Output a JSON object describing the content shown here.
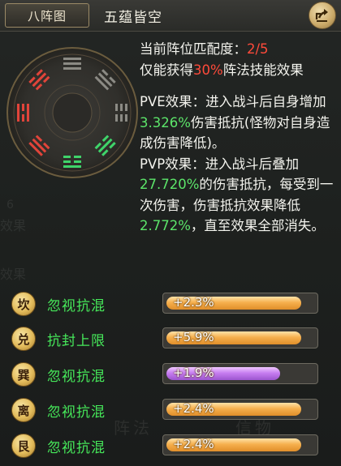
{
  "header": {
    "tab_label": "八阵图",
    "title": "五蕴皆空"
  },
  "info": {
    "match_label": "当前阵位匹配度：",
    "match_value": "2/5",
    "gain_prefix": "仅能获得",
    "gain_percent": "30%",
    "gain_suffix": "阵法技能效果",
    "pve_prefix": "PVE效果：进入战斗后自身增加",
    "pve_value": "3.326%",
    "pve_suffix": "伤害抵抗(怪物对自身造成伤害降低)。",
    "pvp_prefix": "PVP效果：进入战斗后叠加",
    "pvp_value": "27.720%",
    "pvp_mid": "的伤害抵抗，每受到一次伤害，伤害抵抗效果降低",
    "pvp_value2": "2.772%",
    "pvp_suffix": "，直至效果全部消失。"
  },
  "rows": [
    {
      "badge": "坎",
      "skill": "忽视抗混",
      "value_text": "+2.3%",
      "fill": 0.92,
      "color": "orange"
    },
    {
      "badge": "兑",
      "skill": "抗封上限",
      "value_text": "+5.9%",
      "fill": 0.92,
      "color": "orange"
    },
    {
      "badge": "巽",
      "skill": "忽视抗混",
      "value_text": "+1.9%",
      "fill": 0.78,
      "color": "purple"
    },
    {
      "badge": "离",
      "skill": "忽视抗混",
      "value_text": "+2.4%",
      "fill": 0.92,
      "color": "orange"
    },
    {
      "badge": "艮",
      "skill": "忽视抗混",
      "value_text": "+2.4%",
      "fill": 0.92,
      "color": "orange"
    }
  ],
  "colors": {
    "accent_red": "#ff4a3a",
    "accent_green": "#5ce56a",
    "bar_orange": "#f6b04e",
    "bar_purple": "#c77ef0"
  },
  "icons": {
    "share": "share-arrow-icon",
    "wheel": "bagua-wheel-icon"
  }
}
